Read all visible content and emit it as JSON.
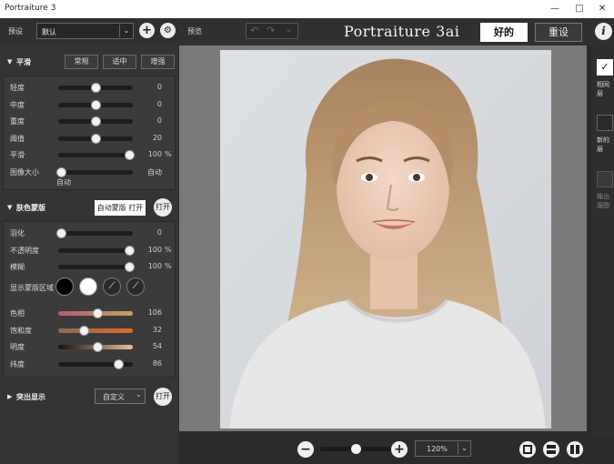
{
  "window": {
    "title": "Portraiture 3",
    "minimize": "—",
    "maximize": "□",
    "close": "✕"
  },
  "topbar": {
    "preset_label": "预设",
    "preset_value": "默认",
    "preview_label": "预览",
    "app_name": "Portraiture 3ai",
    "ok_button": "好的",
    "reset_button": "重设",
    "info_icon": "i"
  },
  "smoothing": {
    "title": "平滑",
    "modes": [
      "常规",
      "适中",
      "增强"
    ],
    "sliders": [
      {
        "label": "轻度",
        "value": "0",
        "unit": "",
        "pos": 0.5
      },
      {
        "label": "中度",
        "value": "0",
        "unit": "",
        "pos": 0.5
      },
      {
        "label": "重度",
        "value": "0",
        "unit": "",
        "pos": 0.5
      },
      {
        "label": "阈值",
        "value": "20",
        "unit": "",
        "pos": 0.5
      },
      {
        "label": "平滑",
        "value": "100",
        "unit": "%",
        "pos": 0.95
      },
      {
        "label": "图像大小",
        "value": "自动",
        "unit": "",
        "pos": 0.04
      }
    ],
    "image_size_note": "自动"
  },
  "skin_mask": {
    "title": "肤色蒙版",
    "auto_mask_button": "自动蒙版 打开",
    "toggle": "打开",
    "sliders": [
      {
        "label": "羽化",
        "value": "0",
        "unit": "",
        "pos": 0.04
      },
      {
        "label": "不透明度",
        "value": "100",
        "unit": "%",
        "pos": 0.95
      },
      {
        "label": "模糊",
        "value": "100",
        "unit": "%",
        "pos": 0.95
      }
    ],
    "show_mask_label": "显示蒙版区域",
    "color_sliders": [
      {
        "label": "色相",
        "value": "106",
        "pos": 0.52
      },
      {
        "label": "饱和度",
        "value": "32",
        "pos": 0.34
      },
      {
        "label": "明度",
        "value": "54",
        "pos": 0.52
      },
      {
        "label": "纬度",
        "value": "86",
        "pos": 0.8
      }
    ]
  },
  "highlight": {
    "title": "突出显示",
    "preset": "自定义",
    "toggle": "打开"
  },
  "right_tools": [
    {
      "label": "相同层"
    },
    {
      "label": "新的层"
    },
    {
      "label": "输出 源图"
    }
  ],
  "bottom": {
    "zoom_value": "120%",
    "zoom_level": 0.5
  },
  "colors": {
    "panel": "#343434",
    "accent_white": "#ffffff",
    "dark": "#2b2b2b"
  }
}
